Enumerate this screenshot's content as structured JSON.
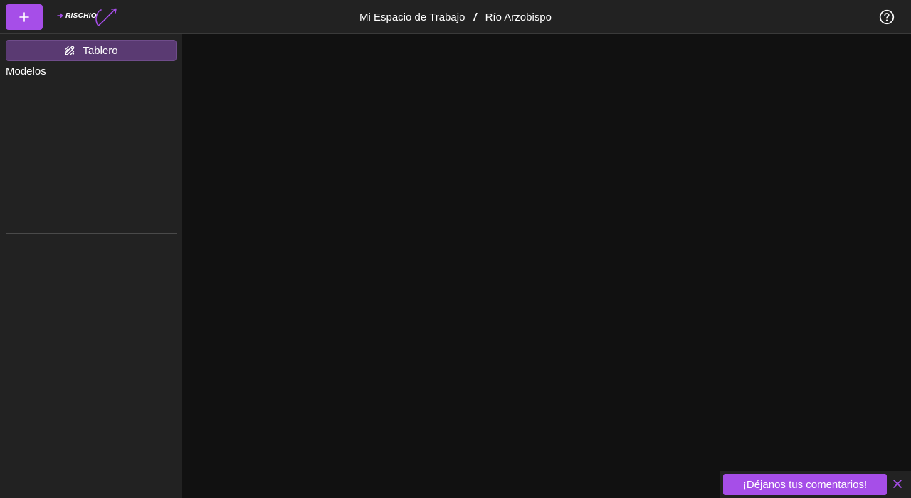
{
  "header": {
    "logo_text": "RISCHIO",
    "breadcrumb": {
      "workspace": "Mi Espacio de Trabajo",
      "separator": "/",
      "project": "Río Arzobispo"
    }
  },
  "sidebar": {
    "dashboard_label": "Tablero",
    "section_label": "Modelos"
  },
  "feedback": {
    "label": "¡Déjanos tus comentarios!"
  },
  "colors": {
    "accent": "#a64ee8",
    "sidebar_selected": "#5a3a72",
    "panel": "#222222",
    "background": "#111111"
  },
  "icons": {
    "add": "plus-icon",
    "help": "help-circle-icon",
    "dashboard": "edit-dashboard-icon",
    "close": "close-icon"
  }
}
